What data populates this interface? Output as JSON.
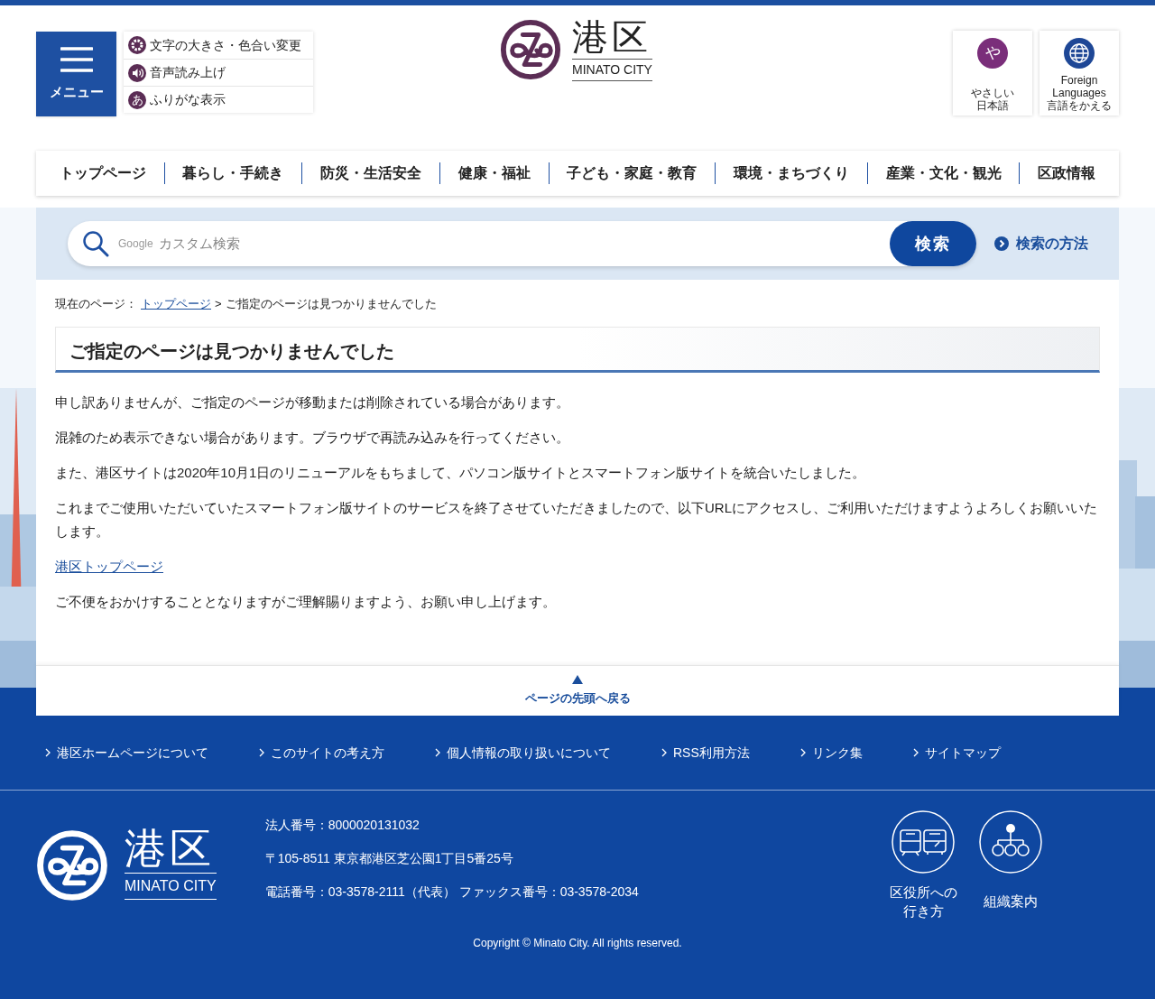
{
  "menu_button": {
    "label": "メニュー"
  },
  "tools": [
    {
      "kind": "gear",
      "label": "文字の大きさ・色合い変更"
    },
    {
      "kind": "speaker",
      "label": "音声読み上げ"
    },
    {
      "kind": "furigana",
      "icon": "あ",
      "label": "ふりがな表示"
    }
  ],
  "logo": {
    "name": "港区",
    "name_en": "MINATO CITY"
  },
  "language_buttons": [
    {
      "kind": "easy",
      "icon": "や",
      "lines": [
        "やさしい",
        "日本語"
      ]
    },
    {
      "kind": "globe",
      "lines": [
        "Foreign",
        "Languages",
        "言語をかえる"
      ]
    }
  ],
  "nav": [
    "トップページ",
    "暮らし・手続き",
    "防災・生活安全",
    "健康・福祉",
    "子ども・家庭・教育",
    "環境・まちづくり",
    "産業・文化・観光",
    "区政情報"
  ],
  "search": {
    "brand": "Google",
    "placeholder": "カスタム検索",
    "button": "検索",
    "help_link": "検索の方法"
  },
  "breadcrumb": {
    "label": "現在のページ：",
    "links": [
      "トップページ"
    ],
    "separator": ">",
    "current": "ご指定のページは見つかりませんでした"
  },
  "heading": "ご指定のページは見つかりませんでした",
  "paragraphs": [
    {
      "kind": "text",
      "text": "申し訳ありませんが、ご指定のページが移動または削除されている場合があります。"
    },
    {
      "kind": "text",
      "text": "混雑のため表示できない場合があります。ブラウザで再読み込みを行ってください。"
    },
    {
      "kind": "text",
      "text": "また、港区サイトは2020年10月1日のリニューアルをもちまして、パソコン版サイトとスマートフォン版サイトを統合いたしました。"
    },
    {
      "kind": "text",
      "text": "これまでご使用いただいていたスマートフォン版サイトのサービスを終了させていただきましたので、以下URLにアクセスし、ご利用いただけますようよろしくお願いいたします。"
    },
    {
      "kind": "link",
      "text": "港区トップページ"
    },
    {
      "kind": "text",
      "text": "ご不便をおかけすることとなりますがご理解賜りますよう、お願い申し上げます。"
    }
  ],
  "back_to_top": "ページの先頭へ戻る",
  "footer_links": [
    "港区ホームページについて",
    "このサイトの考え方",
    "個人情報の取り扱いについて",
    "RSS利用方法",
    "リンク集",
    "サイトマップ"
  ],
  "footer_logo": {
    "name": "港区",
    "name_en": "MINATO CITY"
  },
  "footer_info": [
    "法人番号：8000020131032",
    "〒105-8511 東京都港区芝公園1丁目5番25号",
    "電話番号：03-3578-2111（代表） ファックス番号：03-3578-2034"
  ],
  "footer_buttons": [
    {
      "kind": "transport",
      "lines": [
        "区役所への",
        "行き方"
      ]
    },
    {
      "kind": "org",
      "lines": [
        "組織案内"
      ]
    }
  ],
  "copyright": "Copyright © Minato City. All rights reserved."
}
